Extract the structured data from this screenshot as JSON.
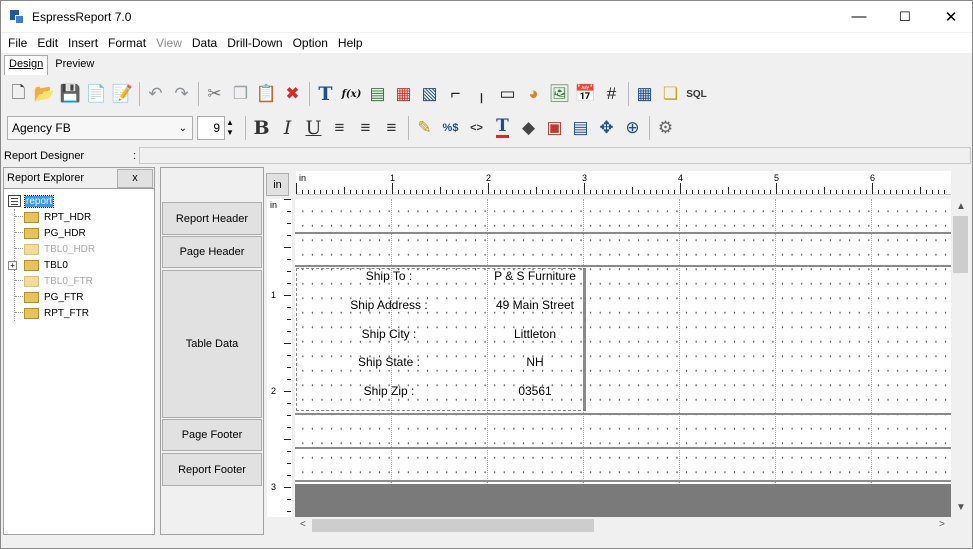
{
  "window": {
    "title": "EspressReport 7.0",
    "minimize": "—",
    "maximize": "☐",
    "close": "✕"
  },
  "menu": [
    "File",
    "Edit",
    "Insert",
    "Format",
    "View",
    "Data",
    "Drill-Down",
    "Option",
    "Help"
  ],
  "menu_disabled": [
    "View"
  ],
  "tabs": [
    {
      "label": "Design",
      "active": true
    },
    {
      "label": "Preview",
      "active": false
    }
  ],
  "toolbar1": [
    {
      "icon": "new-icon",
      "glyph": "🗋"
    },
    {
      "icon": "open-icon",
      "glyph": "📂"
    },
    {
      "icon": "save-icon",
      "glyph": "💾"
    },
    {
      "icon": "export-icon",
      "glyph": "📄"
    },
    {
      "icon": "page-setup-icon",
      "glyph": "📝"
    },
    {
      "icon": "undo-icon",
      "glyph": "↶"
    },
    {
      "icon": "redo-icon",
      "glyph": "↷"
    },
    {
      "icon": "cut-icon",
      "glyph": "✂"
    },
    {
      "icon": "copy-icon",
      "glyph": "❐"
    },
    {
      "icon": "paste-icon",
      "glyph": "📋"
    },
    {
      "icon": "delete-icon",
      "glyph": "✖"
    },
    {
      "icon": "insert-text-icon",
      "glyph": "T"
    },
    {
      "icon": "insert-formula-icon",
      "glyph": "f(x)"
    },
    {
      "icon": "insert-column-icon",
      "glyph": "▤"
    },
    {
      "icon": "insert-label-icon",
      "glyph": "▦"
    },
    {
      "icon": "insert-subreport-icon",
      "glyph": "▧"
    },
    {
      "icon": "insert-line-icon",
      "glyph": "⌐"
    },
    {
      "icon": "insert-vline-icon",
      "glyph": "╷"
    },
    {
      "icon": "insert-rect-icon",
      "glyph": "▭"
    },
    {
      "icon": "insert-chart-icon",
      "glyph": "◕"
    },
    {
      "icon": "insert-image-icon",
      "glyph": "🖼"
    },
    {
      "icon": "insert-date-icon",
      "glyph": "📅"
    },
    {
      "icon": "insert-page-number-icon",
      "glyph": "#"
    },
    {
      "icon": "table-icon",
      "glyph": "▦"
    },
    {
      "icon": "parameter-icon",
      "glyph": "❏"
    },
    {
      "icon": "sql-icon",
      "glyph": "SQL"
    }
  ],
  "font": {
    "name": "Agency FB",
    "size": "9"
  },
  "toolbar2": [
    {
      "icon": "bold-icon",
      "glyph": "B"
    },
    {
      "icon": "italic-icon",
      "glyph": "I"
    },
    {
      "icon": "underline-icon",
      "glyph": "U"
    },
    {
      "icon": "align-left-icon",
      "glyph": "≡"
    },
    {
      "icon": "align-center-icon",
      "glyph": "≡"
    },
    {
      "icon": "align-right-icon",
      "glyph": "≡"
    },
    {
      "icon": "edit-icon",
      "glyph": "✎"
    },
    {
      "icon": "format-icon",
      "glyph": "%$"
    },
    {
      "icon": "html-icon",
      "glyph": "<>"
    },
    {
      "icon": "font-color-icon",
      "glyph": "T"
    },
    {
      "icon": "fill-color-icon",
      "glyph": "◆"
    },
    {
      "icon": "border-icon",
      "glyph": "▣"
    },
    {
      "icon": "properties-icon",
      "glyph": "▤"
    },
    {
      "icon": "move-icon",
      "glyph": "✥"
    },
    {
      "icon": "align-objects-icon",
      "glyph": "⊕"
    },
    {
      "icon": "settings-icon",
      "glyph": "⚙"
    }
  ],
  "designer": {
    "label": "Report Designer",
    "colon": ":"
  },
  "explorer": {
    "title": "Report Explorer",
    "close": "x",
    "root": "report",
    "items": [
      {
        "label": "RPT_HDR",
        "dim": false,
        "expandable": false
      },
      {
        "label": "PG_HDR",
        "dim": false,
        "expandable": false
      },
      {
        "label": "TBL0_HDR",
        "dim": true,
        "expandable": false
      },
      {
        "label": "TBL0",
        "dim": false,
        "expandable": true
      },
      {
        "label": "TBL0_FTR",
        "dim": true,
        "expandable": false
      },
      {
        "label": "PG_FTR",
        "dim": false,
        "expandable": false
      },
      {
        "label": "RPT_FTR",
        "dim": false,
        "expandable": false
      }
    ]
  },
  "sections": [
    "Report Header",
    "Page Header",
    "Table Data",
    "Page Footer",
    "Report Footer"
  ],
  "unit": "in",
  "ruler": {
    "h_unit": "in",
    "h_labels": [
      "1",
      "2",
      "3",
      "4",
      "5",
      "6"
    ],
    "v_unit": "in",
    "v_labels": [
      "1",
      "2",
      "3"
    ]
  },
  "table": {
    "rows": [
      {
        "label": "Ship To :",
        "value": "P & S Furniture"
      },
      {
        "label": "Ship Address :",
        "value": "49 Main Street"
      },
      {
        "label": "Ship City :",
        "value": "Littleton"
      },
      {
        "label": "Ship State :",
        "value": "NH"
      },
      {
        "label": "Ship Zip :",
        "value": "03561"
      }
    ]
  },
  "colors": {
    "selection": "#3399ff",
    "folder": "#e8c25a",
    "canvas_bottom": "#7a7a7a"
  }
}
